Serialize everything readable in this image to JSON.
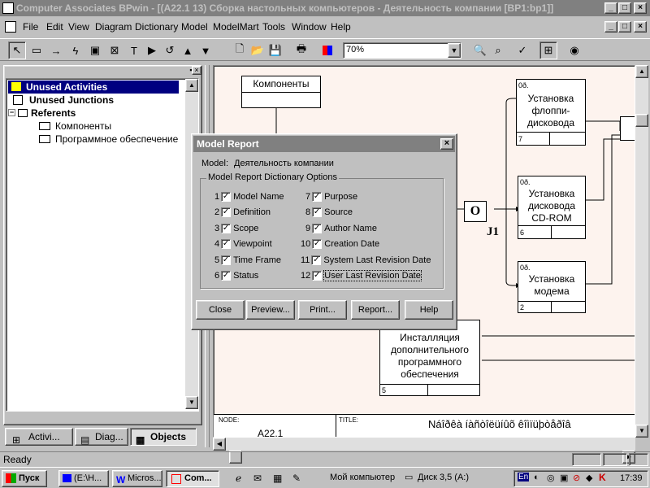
{
  "window": {
    "title": "Computer Associates BPwin - [(A22.1 13) Сборка настольных компьютеров - Деятельность компании  [BP1:bp1]]"
  },
  "menu": [
    "File",
    "Edit",
    "View",
    "Diagram",
    "Dictionary",
    "Model",
    "ModelMart",
    "Tools",
    "Window",
    "Help"
  ],
  "toolbar": {
    "zoom": "70%"
  },
  "browser": {
    "items": [
      "Unused Activities",
      "Unused Junctions",
      "Referents",
      "Компоненты",
      "Программное обеспечение"
    ],
    "tabs": [
      "Activi...",
      "Diag...",
      "Objects"
    ]
  },
  "diagram": {
    "comp": "Компоненты",
    "a1": [
      "Установка",
      "флоппи-",
      "дисковода"
    ],
    "a1num": "7",
    "a2": [
      "Установка",
      "дисковода",
      "CD-ROM"
    ],
    "a2num": "6",
    "a3": [
      "Установка",
      "модема"
    ],
    "a3num": "2",
    "a4": [
      "Инсталляция",
      "дополнительного",
      "программного",
      "обеспечения"
    ],
    "a4num": "5",
    "junction": "O",
    "junctionLabel": "J1",
    "tag": "0ð.",
    "node": "NODE:",
    "title": "TITLE:",
    "nodeVal": "A22.1",
    "titleVal": "Náîðêà íàñòîëüíûõ  êîìïüþòåðîâ"
  },
  "dialog": {
    "title": "Model Report",
    "modelLabel": "Model:",
    "modelName": "Деятельность компании",
    "group": "Model Report Dictionary Options",
    "options": [
      {
        "n": "1",
        "label": "Model Name"
      },
      {
        "n": "2",
        "label": "Definition"
      },
      {
        "n": "3",
        "label": "Scope"
      },
      {
        "n": "4",
        "label": "Viewpoint"
      },
      {
        "n": "5",
        "label": "Time Frame"
      },
      {
        "n": "6",
        "label": "Status"
      },
      {
        "n": "7",
        "label": "Purpose"
      },
      {
        "n": "8",
        "label": "Source"
      },
      {
        "n": "9",
        "label": "Author Name"
      },
      {
        "n": "10",
        "label": "Creation Date"
      },
      {
        "n": "11",
        "label": "System Last Revision Date"
      },
      {
        "n": "12",
        "label": "User Last Revision Date"
      }
    ],
    "buttons": [
      "Close",
      "Preview...",
      "Print...",
      "Report...",
      "Help"
    ]
  },
  "status": "Ready",
  "taskbar": {
    "start": "Пуск",
    "tasks": [
      "(E:\\H...",
      "Micros...",
      "Com..."
    ],
    "info1": "Мой компьютер",
    "info2": "Диск 3,5 (A:)",
    "lang": "En",
    "time": "17:39"
  }
}
